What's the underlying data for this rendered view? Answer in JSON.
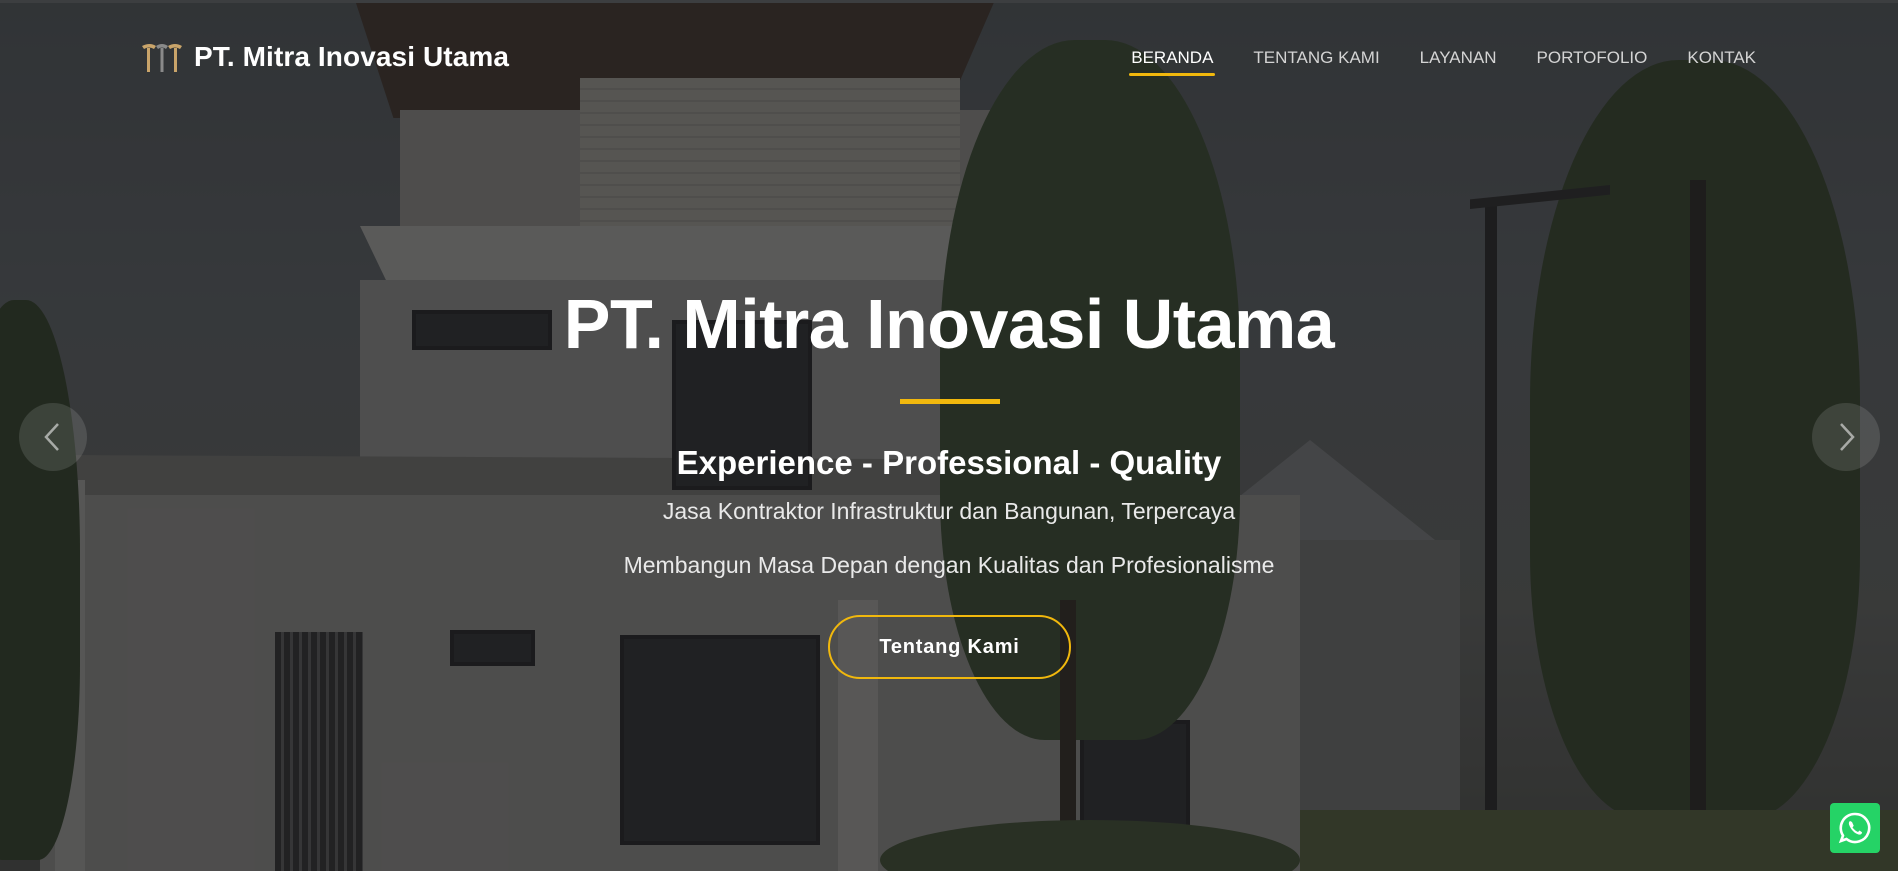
{
  "brand": {
    "name": "PT. Mitra Inovasi Utama",
    "logo_icon": "building-pillars-logo-icon"
  },
  "nav": {
    "items": [
      {
        "label": "BERANDA",
        "active": true
      },
      {
        "label": "TENTANG KAMI",
        "active": false
      },
      {
        "label": "LAYANAN",
        "active": false
      },
      {
        "label": "PORTOFOLIO",
        "active": false
      },
      {
        "label": "KONTAK",
        "active": false
      }
    ]
  },
  "hero": {
    "title": "PT. Mitra Inovasi Utama",
    "tagline": "Experience - Professional - Quality",
    "subtitle": "Jasa Kontraktor Infrastruktur dan Bangunan, Terpercaya",
    "description": "Membangun Masa Depan dengan Kualitas dan Profesionalisme",
    "cta_label": "Tentang Kami"
  },
  "carousel": {
    "prev_icon": "chevron-left-icon",
    "next_icon": "chevron-right-icon"
  },
  "floating": {
    "whatsapp_icon": "whatsapp-icon"
  },
  "colors": {
    "accent": "#f1b80d",
    "whatsapp": "#25d366",
    "text": "#ffffff"
  }
}
